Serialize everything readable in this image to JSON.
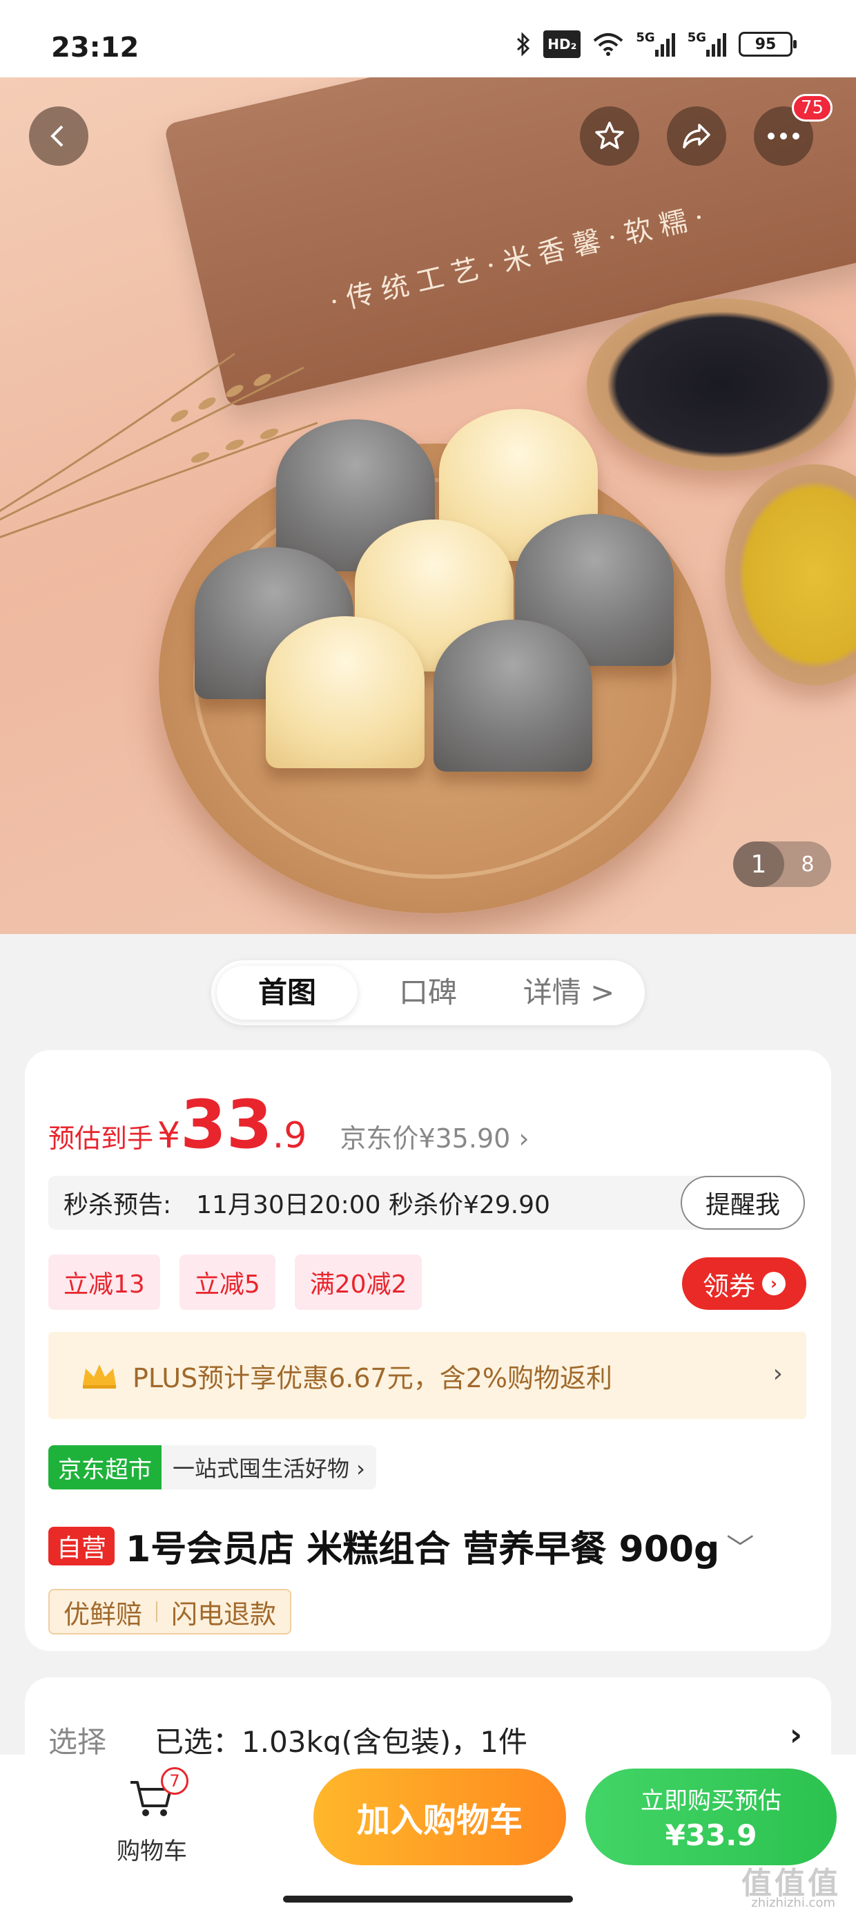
{
  "status_bar": {
    "time": "23:12",
    "hd_label": "HD₂",
    "sim1": "5G",
    "sim2": "5G",
    "battery": "95"
  },
  "hero": {
    "bag_text": "·传统工艺·米香馨·软糯·",
    "cart_badge": "75",
    "pager_current": "1",
    "pager_total": "8"
  },
  "tabs": [
    {
      "label": "首图"
    },
    {
      "label": "口碑"
    },
    {
      "label": "详情 >"
    }
  ],
  "price": {
    "est_label": "预估到手",
    "currency": "¥",
    "int": "33",
    "dec": ".9",
    "jd_price": "京东价¥35.90 ›"
  },
  "seckill": {
    "label": "秒杀预告:",
    "info": "11月30日20:00 秒杀价¥29.90",
    "remind_label": "提醒我"
  },
  "coupons": [
    "立减13",
    "立减5",
    "满20减2"
  ],
  "claim_label": "领券",
  "plus": {
    "text": "PLUS预计享优惠6.67元，含2%购物返利"
  },
  "store": {
    "badge": "京东超市",
    "slogan": "一站式囤生活好物 ›"
  },
  "product": {
    "self_badge": "自营",
    "title": "1号会员店 米糕组合 营养早餐 900g"
  },
  "services": [
    "优鲜赔",
    "闪电退款"
  ],
  "selection": {
    "label": "选择",
    "value": "已选：1.03kg(含包装)，1件"
  },
  "bottom": {
    "cart_count": "7",
    "cart_label": "购物车",
    "add_cart_label": "加入购物车",
    "buy_label": "立即购买预估",
    "buy_price": "¥33.9"
  },
  "watermark": {
    "main": "值值值",
    "sub": "zhizhizhi.com"
  },
  "colors": {
    "accent_red": "#e8252d",
    "green": "#2cc24f",
    "orange": "#ff8a1f",
    "plus_gold": "#a0692c"
  }
}
